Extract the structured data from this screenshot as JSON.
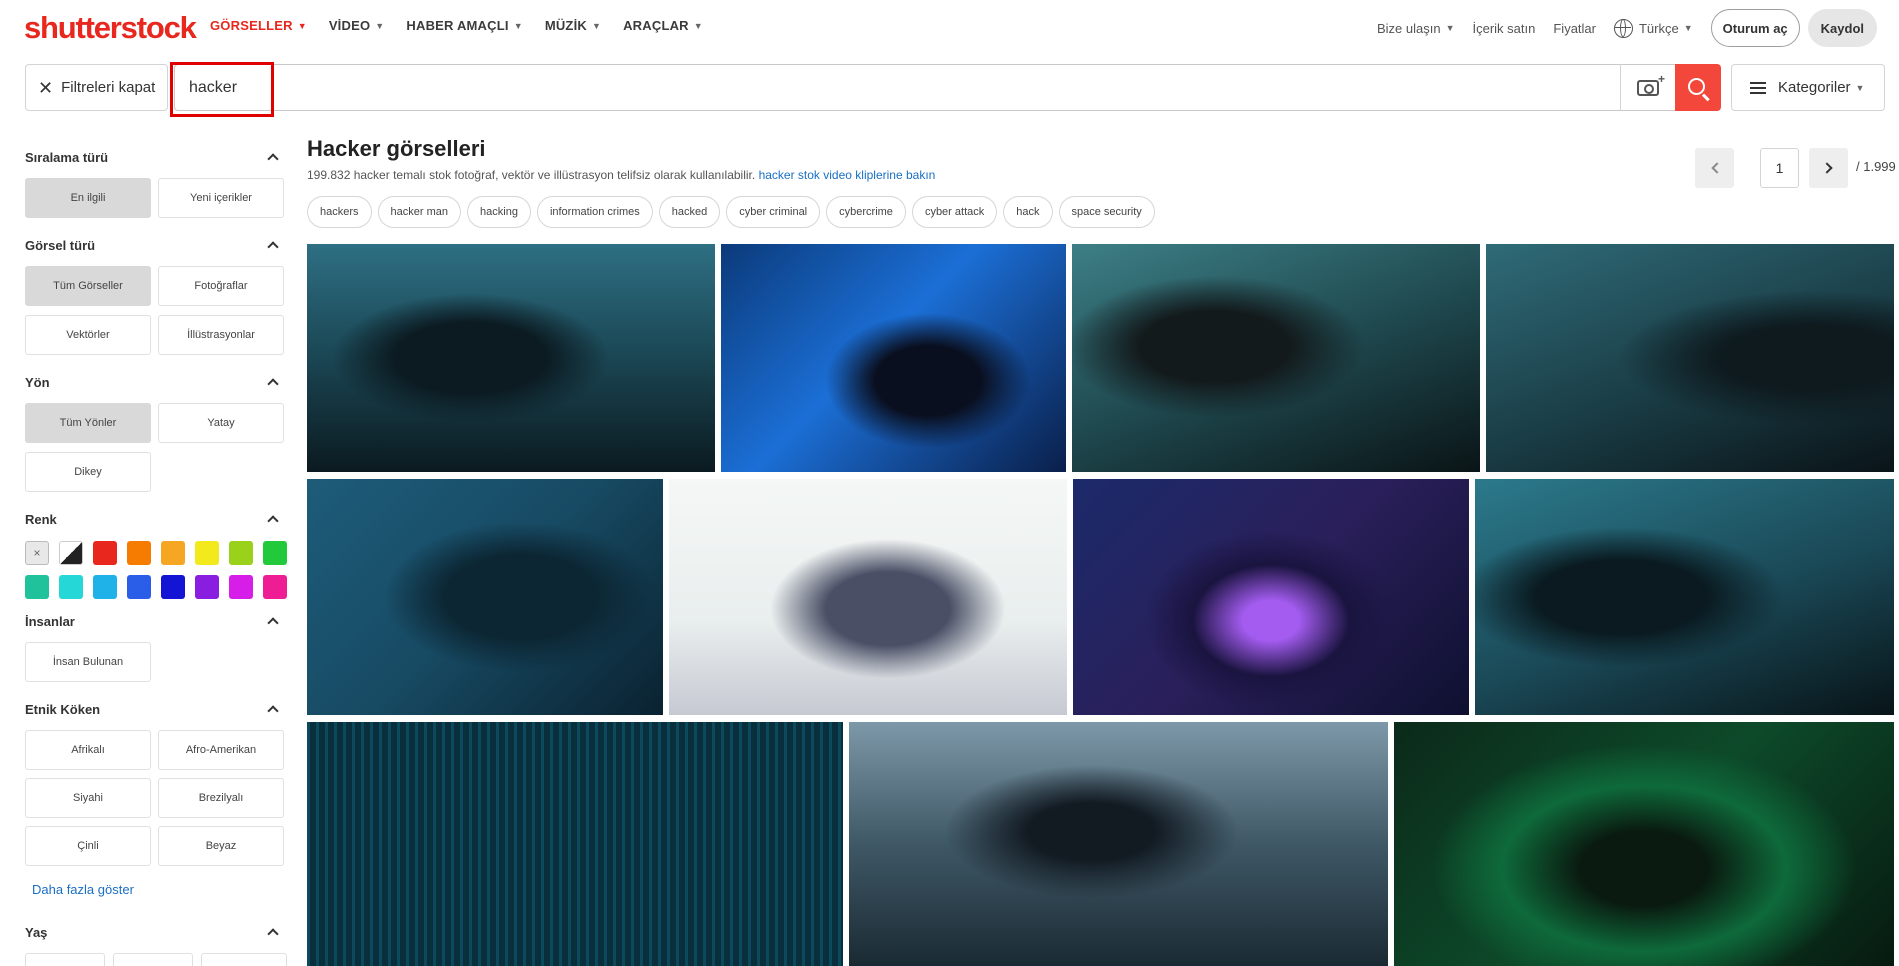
{
  "brand": {
    "logo_text": "shutterstock"
  },
  "nav": {
    "links": [
      {
        "label": "GÖRSELLER"
      },
      {
        "label": "VİDEO"
      },
      {
        "label": "HABER AMAÇLI"
      },
      {
        "label": "MÜZİK"
      },
      {
        "label": "ARAÇLAR"
      }
    ],
    "right": {
      "contact": "Bize ulaşın",
      "sell": "İçerik satın",
      "pricing": "Fiyatlar",
      "language": "Türkçe",
      "signin": "Oturum aç",
      "register": "Kaydol"
    }
  },
  "search": {
    "close_filters": "Filtreleri kapat",
    "query": "hacker",
    "categories": "Kategoriler"
  },
  "sidebar": {
    "sort": {
      "title": "Sıralama türü",
      "options": [
        "En ilgili",
        "Yeni içerikler"
      ]
    },
    "image_type": {
      "title": "Görsel türü",
      "options": [
        "Tüm Görseller",
        "Fotoğraflar",
        "Vektörler",
        "İllüstrasyonlar"
      ]
    },
    "orientation": {
      "title": "Yön",
      "options": [
        "Tüm Yönler",
        "Yatay",
        "Dikey"
      ]
    },
    "color": {
      "title": "Renk",
      "swatches": [
        "#e8e8e8",
        "#222222",
        "#e8281e",
        "#f57c00",
        "#f5a623",
        "#f2ea1d",
        "#9ad21b",
        "#22c93a",
        "#1fc29a",
        "#25d7d7",
        "#1fb2e8",
        "#2a5ee8",
        "#1414d4",
        "#8a1ee0",
        "#d61ee8",
        "#ef1d94"
      ]
    },
    "people": {
      "title": "İnsanlar",
      "options": [
        "İnsan Bulunan"
      ]
    },
    "ethnicity": {
      "title": "Etnik Köken",
      "options": [
        "Afrikalı",
        "Afro-Amerikan",
        "Siyahi",
        "Brezilyalı",
        "Çinli",
        "Beyaz"
      ]
    },
    "show_more": "Daha fazla göster",
    "age": {
      "title": "Yaş"
    }
  },
  "main": {
    "title": "Hacker görselleri",
    "subtitle": "199.832 hacker temalı stok fotoğraf, vektör ve illüstrasyon telifsiz olarak kullanılabilir.",
    "subtitle_link": "hacker stok video kliplerine bakın",
    "pager": {
      "current": "1",
      "total": "/ 1.999"
    },
    "tags": [
      "hackers",
      "hacker man",
      "hacking",
      "information crimes",
      "hacked",
      "cyber criminal",
      "cybercrime",
      "cyber attack",
      "hack",
      "space security"
    ]
  }
}
